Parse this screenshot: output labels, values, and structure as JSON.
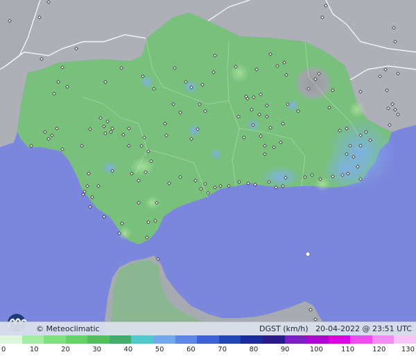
{
  "brand": {
    "copyright": "©",
    "name": "Meteoclimatic"
  },
  "variable": {
    "name": "DGST",
    "unit": "(km/h)"
  },
  "timestamp": "20-04-2022 @ 23:51 UTC",
  "legend": {
    "ticks": [
      "0",
      "10",
      "20",
      "30",
      "40",
      "50",
      "60",
      "70",
      "80",
      "90",
      "100",
      "110",
      "120",
      "130"
    ],
    "colors": [
      "#dcf5dc",
      "#a4eca4",
      "#7ee07e",
      "#62d466",
      "#50c05c",
      "#3fae6a",
      "#4fc9c9",
      "#74a8ec",
      "#5d86e6",
      "#3e62d6",
      "#2146b8",
      "#1a2c9c",
      "#2a1a8a",
      "#7a1ec8",
      "#b000d8",
      "#e000e8",
      "#f04af0",
      "#f48cf4",
      "#f8c4f8"
    ]
  },
  "colors": {
    "sea": "#7b87dc",
    "land_outside": "#aeb0b8",
    "andalusia": "#78c07c",
    "border": "#ffffff"
  }
}
